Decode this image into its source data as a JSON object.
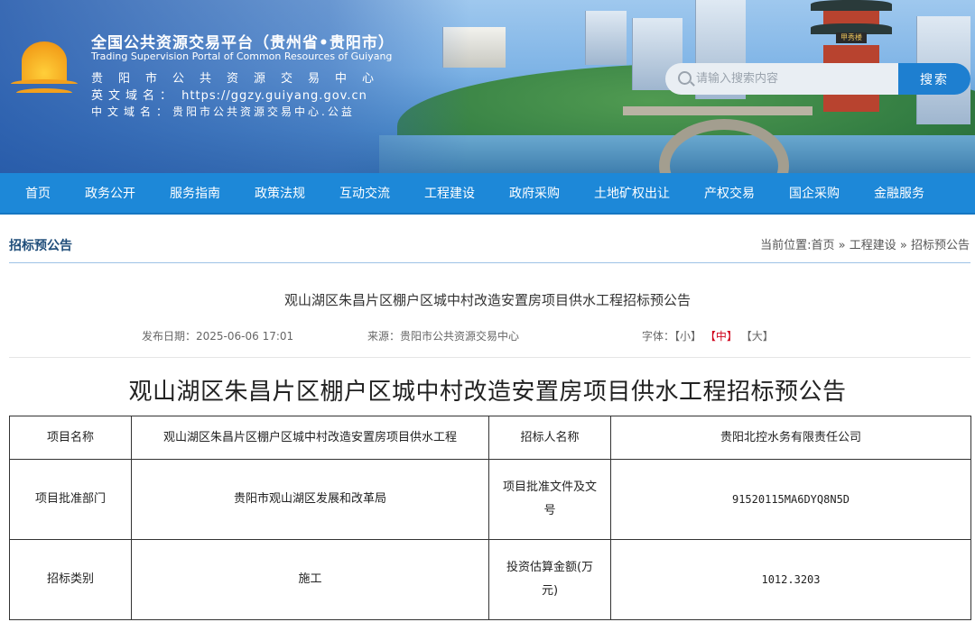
{
  "header": {
    "title_cn": "全国公共资源交易平台（贵州省•贵阳市）",
    "title_en": "Trading Supervision Portal of Common Resources of Guiyang",
    "center_name": "贵阳市公共资源交易中心",
    "en_domain_label": "英文域名：",
    "en_domain": "https://ggzy.guiyang.gov.cn",
    "cn_domain_label": "中文域名：",
    "cn_domain": "贵阳市公共资源交易中心.公益",
    "pagoda_sign": "甲秀楼",
    "search_placeholder": "请输入搜索内容",
    "search_button": "搜索"
  },
  "nav": [
    "首页",
    "政务公开",
    "服务指南",
    "政策法规",
    "互动交流",
    "工程建设",
    "政府采购",
    "土地矿权出让",
    "产权交易",
    "国企采购",
    "金融服务"
  ],
  "breadcrumb": {
    "section_title": "招标预公告",
    "trail": "当前位置:首页 » 工程建设 » 招标预公告"
  },
  "article": {
    "title": "观山湖区朱昌片区棚户区城中村改造安置房项目供水工程招标预公告",
    "publish_label": "发布日期：",
    "publish_date": "2025-06-06 17:01",
    "source_label": "来源：",
    "source": "贵阳市公共资源交易中心",
    "font_label": "字体：",
    "font_small": "【小】",
    "font_medium": "【中】",
    "font_large": "【大】"
  },
  "document": {
    "title": "观山湖区朱昌片区棚户区城中村改造安置房项目供水工程招标预公告",
    "rows": [
      {
        "k1": "项目名称",
        "v1": "观山湖区朱昌片区棚户区城中村改造安置房项目供水工程",
        "k2": "招标人名称",
        "v2": "贵阳北控水务有限责任公司"
      },
      {
        "k1": "项目批准部门",
        "v1": "贵阳市观山湖区发展和改革局",
        "k2": "项目批准文件及文号",
        "v2": "91520115MA6DYQ8N5D"
      },
      {
        "k1": "招标类别",
        "v1": "施工",
        "k2": "投资估算金额(万元)",
        "v2": "1012.3203"
      }
    ]
  }
}
